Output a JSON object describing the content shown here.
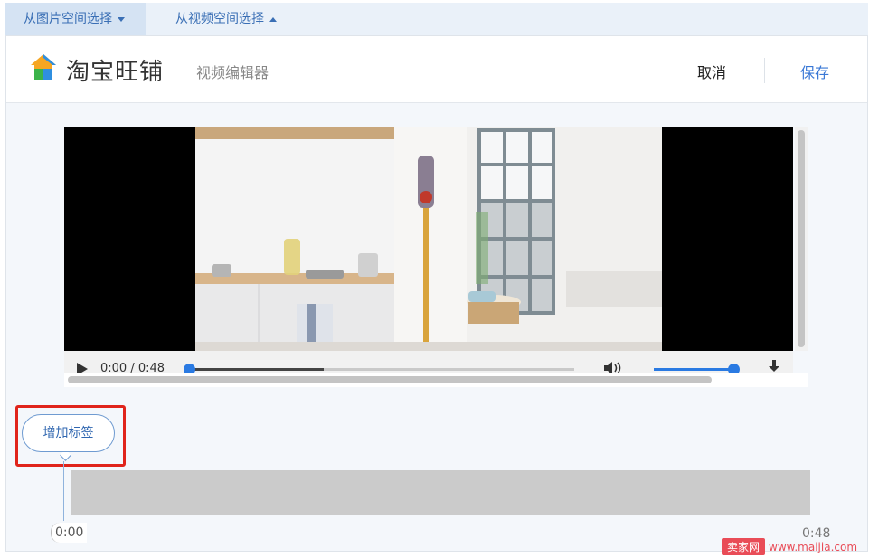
{
  "tabs": {
    "image_space": "从图片空间选择",
    "video_space": "从视频空间选择"
  },
  "header": {
    "brand": "淘宝旺铺",
    "subtitle": "视频编辑器",
    "cancel": "取消",
    "save": "保存"
  },
  "player": {
    "time": "0:00 / 0:48",
    "progress": 0.35,
    "volume": 1.0
  },
  "timeline": {
    "add_tag": "增加标签",
    "start": "0:00",
    "end": "0:48"
  },
  "watermark": {
    "badge": "卖家网",
    "url": "www.maijia.com"
  },
  "colors": {
    "accent": "#3a78d6",
    "highlight": "#e0241b",
    "tab_bg": "#eaf1f9"
  }
}
